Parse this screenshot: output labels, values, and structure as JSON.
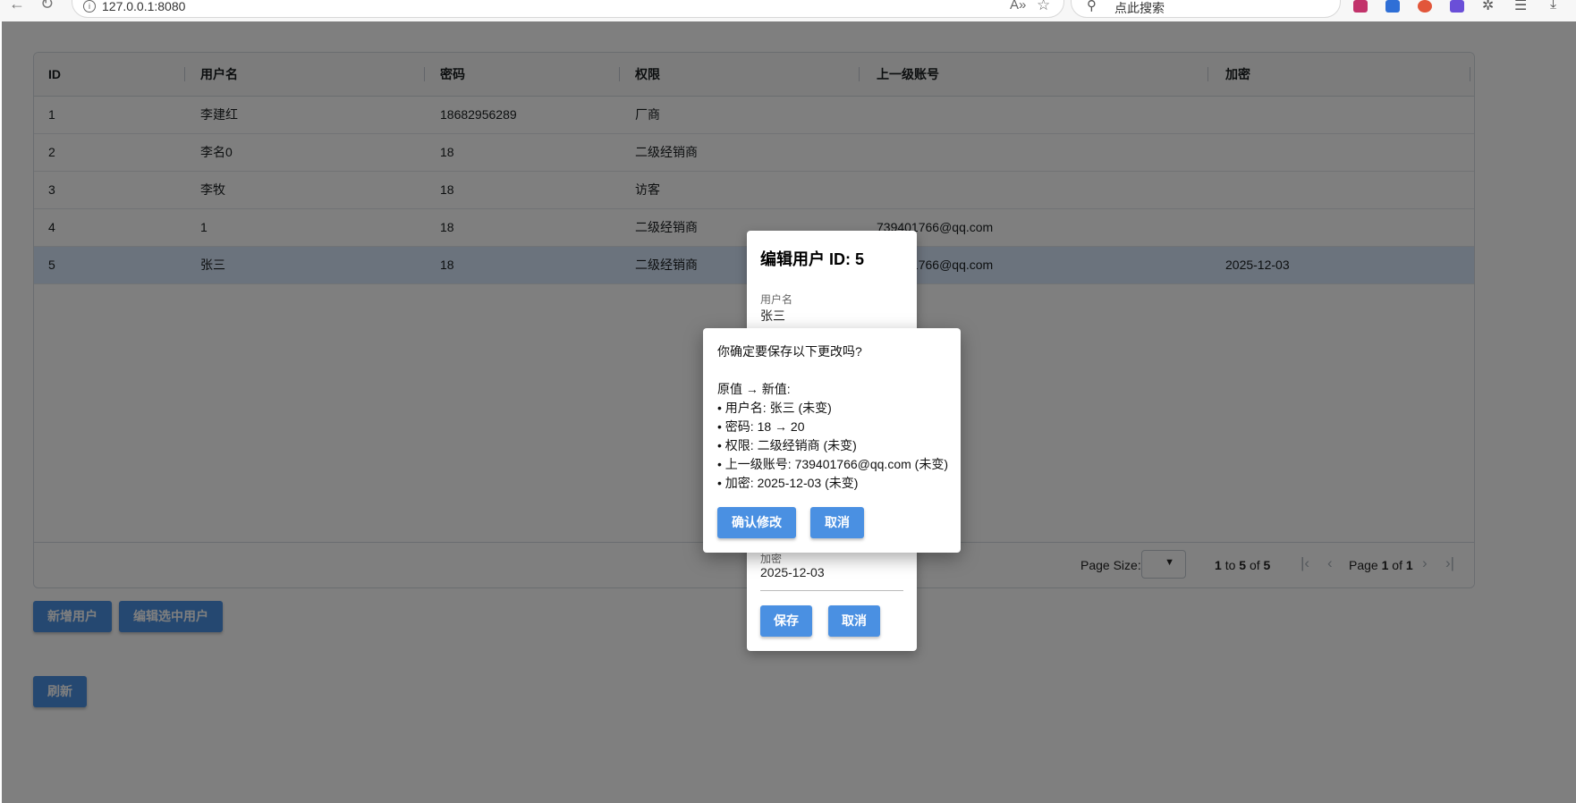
{
  "browser": {
    "url": "127.0.0.1:8080",
    "search_placeholder": "点此搜索"
  },
  "grid": {
    "columns": [
      "ID",
      "用户名",
      "密码",
      "权限",
      "上一级账号",
      "加密"
    ],
    "rows": [
      [
        "1",
        "李建红",
        "18682956289",
        "厂商",
        "",
        ""
      ],
      [
        "2",
        "李名0",
        "18",
        "二级经销商",
        "",
        ""
      ],
      [
        "3",
        "李牧",
        "18",
        "访客",
        "",
        ""
      ],
      [
        "4",
        "1",
        "18",
        "二级经销商",
        "739401766@qq.com",
        ""
      ],
      [
        "5",
        "张三",
        "18",
        "二级经销商",
        "739401766@qq.com",
        "2025-12-03"
      ]
    ],
    "selected_row_id": "5",
    "pagination": {
      "page_size_label": "Page Size:",
      "range_from": "1",
      "range_to": "5",
      "range_total": "5",
      "word_to": "to",
      "word_of": "of",
      "word_page": "Page",
      "page_current": "1",
      "page_total": "1"
    }
  },
  "actions": {
    "add_user": "新增用户",
    "edit_selected": "编辑选中用户",
    "refresh": "刷新"
  },
  "edit_panel": {
    "title": "编辑用户 ID: 5",
    "username_label": "用户名",
    "username_value": "张三",
    "encrypt_label": "加密",
    "encrypt_value": "2025-12-03",
    "save": "保存",
    "cancel": "取消"
  },
  "confirm_dialog": {
    "question": "你确定要保存以下更改吗?",
    "header": "原值 → 新值:",
    "changes": [
      "• 用户名: 张三 (未变)",
      "• 密码: 18 → 20",
      "• 权限: 二级经销商 (未变)",
      "• 上一级账号: 739401766@qq.com (未变)",
      "• 加密: 2025-12-03 (未变)"
    ],
    "confirm": "确认修改",
    "cancel": "取消"
  },
  "colors": {
    "accent": "#4a90e2",
    "selected_row": "#d7e7fb",
    "overlay": "rgba(0,0,0,0.5)"
  }
}
